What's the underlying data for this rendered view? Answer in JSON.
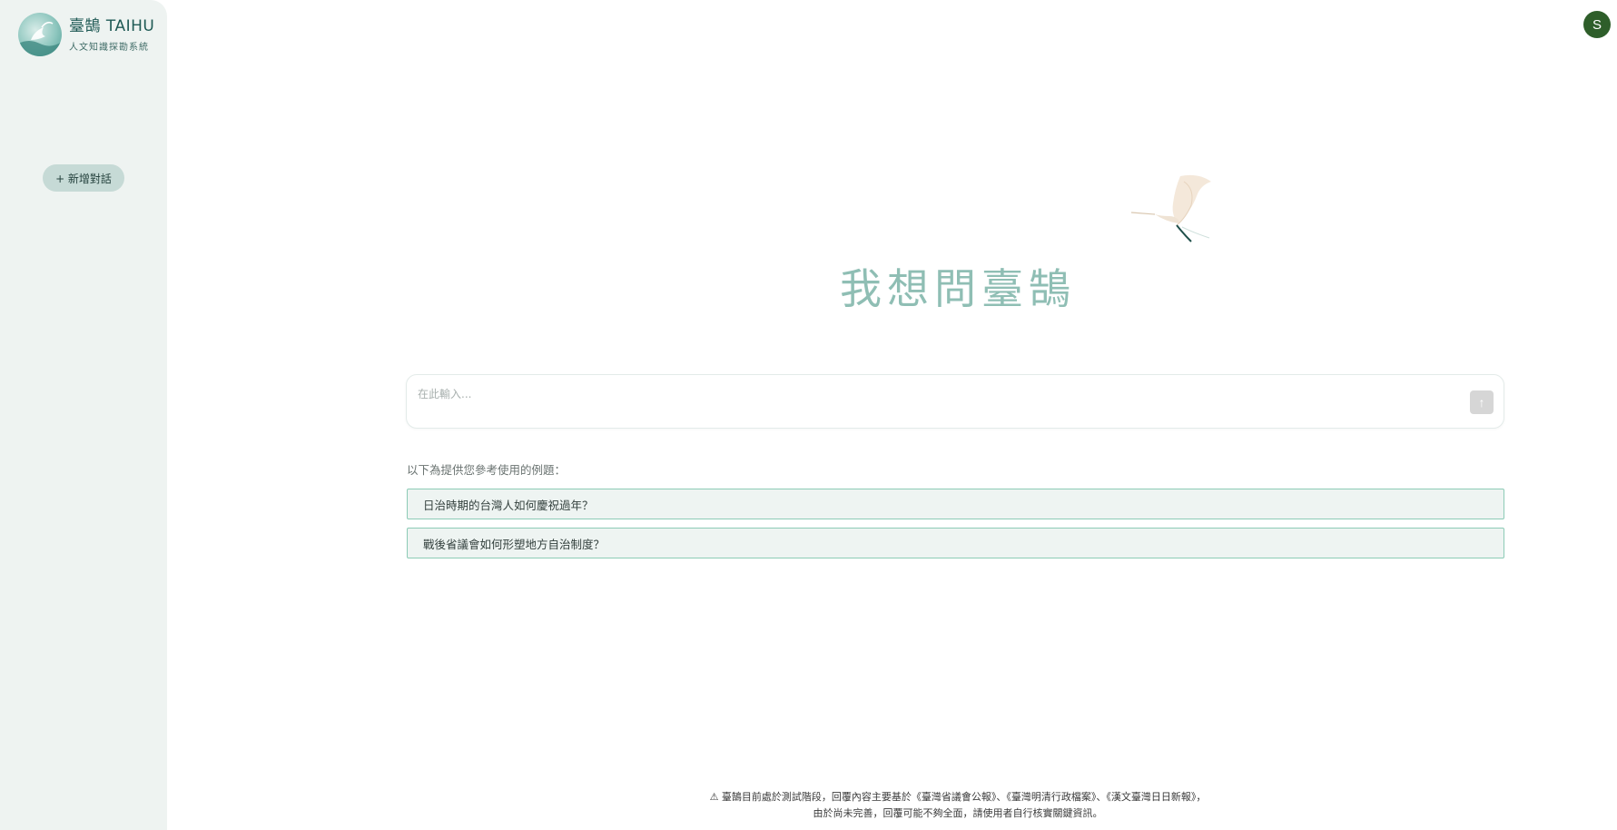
{
  "sidebar": {
    "brand_title": "臺鵠 TAIHU",
    "brand_subtitle": "人文知識探勘系統",
    "new_chat_label": "+ 新增對話"
  },
  "header": {
    "avatar_initial": "S"
  },
  "hero": {
    "title": "我想問臺鵠"
  },
  "input": {
    "placeholder": "在此輸入...",
    "value": "",
    "send_icon": "arrow-up-icon"
  },
  "examples": {
    "label": "以下為提供您參考使用的例題：",
    "items": [
      "日治時期的台灣人如何慶祝過年？",
      "戰後省議會如何形塑地方自治制度？"
    ]
  },
  "footer": {
    "line1": "⚠ 臺鵠目前處於測試階段，回覆內容主要基於《臺灣省議會公報》、《臺灣明清行政檔案》、《漢文臺灣日日新報》，",
    "line2": "由於尚未完善，回覆可能不夠全面，請使用者自行核實關鍵資訊。"
  },
  "colors": {
    "sidebar_bg": "#eef3f1",
    "accent": "#8fbeb4",
    "example_border": "#8ccbb6",
    "avatar_bg": "#2e5e2a"
  }
}
